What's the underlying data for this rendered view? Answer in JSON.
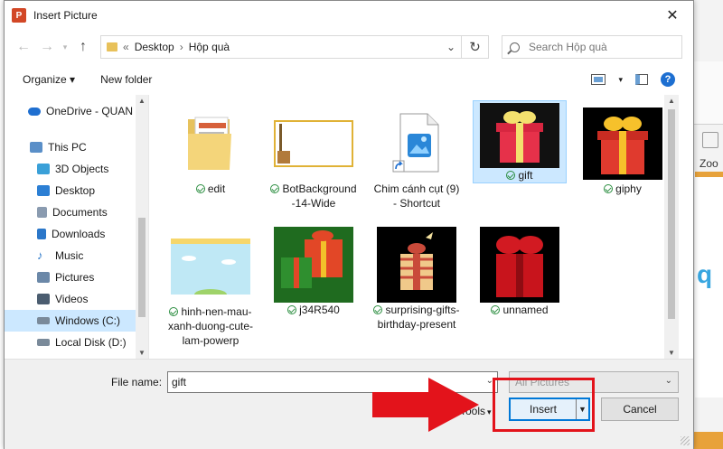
{
  "window": {
    "title": "Insert Picture",
    "app_icon_letter": "P"
  },
  "navigation": {
    "breadcrumb": [
      "Desktop",
      "Hộp quà"
    ],
    "breadcrumb_prefix": "«",
    "search_placeholder": "Search Hộp quà"
  },
  "toolbar": {
    "organize": "Organize",
    "new_folder": "New folder",
    "help": "?"
  },
  "sidebar": {
    "items": [
      {
        "label": "OneDrive - QUAN",
        "icon": "cloud-icon",
        "color": "#1f6fd0"
      },
      {
        "label": "This PC",
        "icon": "computer-icon",
        "color": "#5a8fc8"
      },
      {
        "label": "3D Objects",
        "icon": "cube-icon",
        "color": "#3aa0d8"
      },
      {
        "label": "Desktop",
        "icon": "desktop-icon",
        "color": "#2c7fd4"
      },
      {
        "label": "Documents",
        "icon": "document-icon",
        "color": "#8a9bb0"
      },
      {
        "label": "Downloads",
        "icon": "download-icon",
        "color": "#2b77c9"
      },
      {
        "label": "Music",
        "icon": "music-icon",
        "color": "#2b77c9"
      },
      {
        "label": "Pictures",
        "icon": "pictures-icon",
        "color": "#6b88a8"
      },
      {
        "label": "Videos",
        "icon": "video-icon",
        "color": "#4b5d70"
      },
      {
        "label": "Windows (C:)",
        "icon": "drive-icon",
        "color": "#7a8a9a"
      },
      {
        "label": "Local Disk (D:)",
        "icon": "disk-icon",
        "color": "#7a8a9a"
      }
    ]
  },
  "files": [
    {
      "name": "edit",
      "kind": "folder"
    },
    {
      "name": "BotBackground-14-Wide",
      "kind": "image"
    },
    {
      "name": "Chim cánh cụt (9) - Shortcut",
      "kind": "shortcut"
    },
    {
      "name": "gift",
      "kind": "image",
      "selected": true
    },
    {
      "name": "giphy",
      "kind": "image"
    },
    {
      "name": "hinh-nen-mau-xanh-duong-cute-lam-powerp",
      "kind": "image"
    },
    {
      "name": "j34R540",
      "kind": "image"
    },
    {
      "name": "surprising-gifts-birthday-present",
      "kind": "image"
    },
    {
      "name": "unnamed",
      "kind": "image"
    }
  ],
  "bottom": {
    "file_name_label": "File name:",
    "file_name_value": "gift",
    "filter": "All Pictures",
    "tools": "Tools",
    "insert": "Insert",
    "cancel": "Cancel"
  },
  "background_app": {
    "zoom_label": "Zoo",
    "slide_letter": "q"
  },
  "colors": {
    "annotation": "#e3131b",
    "selection": "#cce8ff",
    "accent": "#0078d7"
  }
}
